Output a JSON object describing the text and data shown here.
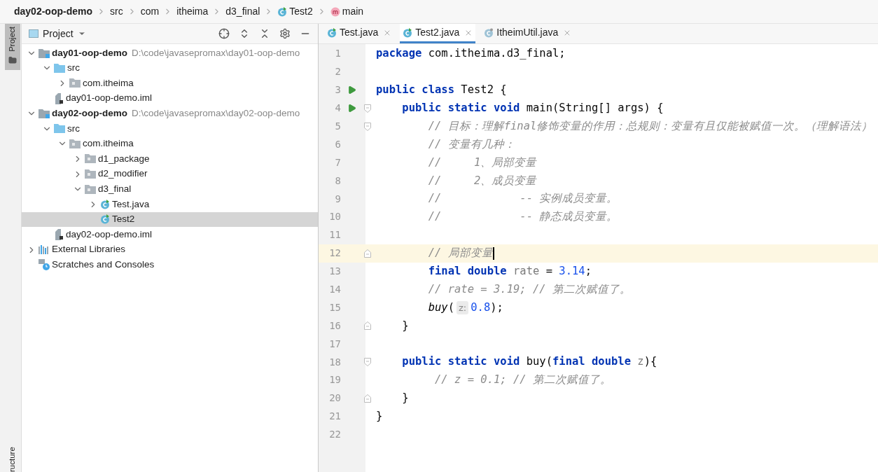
{
  "breadcrumb": [
    {
      "label": "day02-oop-demo",
      "kind": "project"
    },
    {
      "label": "src",
      "kind": "folder"
    },
    {
      "label": "com",
      "kind": "folder"
    },
    {
      "label": "itheima",
      "kind": "folder"
    },
    {
      "label": "d3_final",
      "kind": "folder"
    },
    {
      "label": "Test2",
      "kind": "class"
    },
    {
      "label": "main",
      "kind": "method"
    }
  ],
  "side_stripe": {
    "top": {
      "label": "Project",
      "selected": true
    },
    "bottom": {
      "label": "ructure",
      "selected": false
    }
  },
  "project_panel": {
    "title": "Project",
    "tree": [
      {
        "label": "day01-oop-demo",
        "path": "D:\\code\\javasepromax\\day01-oop-demo",
        "kind": "module",
        "expanded": true,
        "selected": false,
        "children": [
          {
            "label": "src",
            "kind": "source",
            "expanded": true,
            "selected": false,
            "children": [
              {
                "label": "com.itheima",
                "kind": "package",
                "expanded": false,
                "selected": false
              }
            ]
          },
          {
            "label": "day01-oop-demo.iml",
            "kind": "iml",
            "selected": false
          }
        ]
      },
      {
        "label": "day02-oop-demo",
        "path": "D:\\code\\javasepromax\\day02-oop-demo",
        "kind": "module",
        "expanded": true,
        "selected": false,
        "children": [
          {
            "label": "src",
            "kind": "source",
            "expanded": true,
            "selected": false,
            "children": [
              {
                "label": "com.itheima",
                "kind": "package",
                "expanded": true,
                "selected": false,
                "children": [
                  {
                    "label": "d1_package",
                    "kind": "package",
                    "expanded": false,
                    "selected": false
                  },
                  {
                    "label": "d2_modifier",
                    "kind": "package",
                    "expanded": false,
                    "selected": false
                  },
                  {
                    "label": "d3_final",
                    "kind": "package",
                    "expanded": true,
                    "selected": false,
                    "children": [
                      {
                        "label": "Test.java",
                        "kind": "class",
                        "expanded": false,
                        "selected": false
                      },
                      {
                        "label": "Test2",
                        "kind": "class",
                        "selected": true
                      }
                    ]
                  }
                ]
              }
            ]
          },
          {
            "label": "day02-oop-demo.iml",
            "kind": "iml",
            "selected": false
          }
        ]
      },
      {
        "label": "External Libraries",
        "kind": "libraries",
        "expanded": false,
        "selected": false
      },
      {
        "label": "Scratches and Consoles",
        "kind": "scratches",
        "selected": false
      }
    ]
  },
  "tabs": [
    {
      "label": "Test.java",
      "kind": "runnable",
      "selected": false
    },
    {
      "label": "Test2.java",
      "kind": "runnable",
      "selected": true
    },
    {
      "label": "ItheimUtil.java",
      "kind": "plain",
      "selected": false
    }
  ],
  "code": [
    {
      "number": "1",
      "current": false,
      "tokens": [
        {
          "kind": "kw",
          "text": "package"
        },
        {
          "kind": "plain",
          "text": " com.itheima.d3_final;"
        }
      ]
    },
    {
      "number": "2",
      "current": false
    },
    {
      "number": "3",
      "current": false,
      "run": true,
      "tokens": [
        {
          "kind": "kw",
          "text": "public class"
        },
        {
          "kind": "plain",
          "text": " Test2 {"
        }
      ]
    },
    {
      "number": "4",
      "current": false,
      "run": true,
      "fold_open": true,
      "tokens": [
        {
          "kind": "kw",
          "text": "    public static void"
        },
        {
          "kind": "plain",
          "text": " main(String[] args) {"
        }
      ]
    },
    {
      "number": "5",
      "current": false,
      "fold_open": true,
      "tokens": [
        {
          "kind": "comment",
          "text": "        // 目标：理解final修饰变量的作用：总规则：变量有且仅能被赋值一次。（理解语法）"
        }
      ]
    },
    {
      "number": "6",
      "current": false,
      "tokens": [
        {
          "kind": "comment",
          "text": "        // 变量有几种："
        }
      ]
    },
    {
      "number": "7",
      "current": false,
      "tokens": [
        {
          "kind": "comment",
          "text": "        //     1、局部变量"
        }
      ]
    },
    {
      "number": "8",
      "current": false,
      "tokens": [
        {
          "kind": "comment",
          "text": "        //     2、成员变量"
        }
      ]
    },
    {
      "number": "9",
      "current": false,
      "tokens": [
        {
          "kind": "comment",
          "text": "        //            -- 实例成员变量。"
        }
      ]
    },
    {
      "number": "10",
      "current": false,
      "tokens": [
        {
          "kind": "comment",
          "text": "        //            -- 静态成员变量。"
        }
      ]
    },
    {
      "number": "11",
      "current": false
    },
    {
      "number": "12",
      "current": true,
      "fold_close": true,
      "tokens": [
        {
          "kind": "comment",
          "text": "        // 局部变量"
        }
      ]
    },
    {
      "number": "13",
      "current": false,
      "tokens": [
        {
          "kind": "kw",
          "text": "        final double"
        },
        {
          "kind": "unused",
          "text": " rate"
        },
        {
          "kind": "plain",
          "text": " = "
        },
        {
          "kind": "num",
          "text": "3.14"
        },
        {
          "kind": "plain",
          "text": ";"
        }
      ]
    },
    {
      "number": "14",
      "current": false,
      "tokens": [
        {
          "kind": "comment",
          "text": "        // rate = 3.19; // 第二次赋值了。"
        }
      ]
    },
    {
      "number": "15",
      "current": false,
      "tokens": [
        {
          "kind": "call",
          "text": "        buy"
        },
        {
          "kind": "plain",
          "text": "("
        },
        {
          "kind": "hint",
          "text": "z:"
        },
        {
          "kind": "num",
          "text": "0.8"
        },
        {
          "kind": "plain",
          "text": ");"
        }
      ]
    },
    {
      "number": "16",
      "current": false,
      "fold_close": true,
      "tokens": [
        {
          "kind": "plain",
          "text": "    }"
        }
      ]
    },
    {
      "number": "17",
      "current": false
    },
    {
      "number": "18",
      "current": false,
      "fold_open": true,
      "tokens": [
        {
          "kind": "kw",
          "text": "    public static void"
        },
        {
          "kind": "plain",
          "text": " buy("
        },
        {
          "kind": "kw",
          "text": "final double"
        },
        {
          "kind": "unused",
          "text": " z"
        },
        {
          "kind": "plain",
          "text": "){"
        }
      ]
    },
    {
      "number": "19",
      "current": false,
      "tokens": [
        {
          "kind": "comment",
          "text": "         // z = 0.1; // 第二次赋值了。"
        }
      ]
    },
    {
      "number": "20",
      "current": false,
      "fold_close": true,
      "tokens": [
        {
          "kind": "plain",
          "text": "    }"
        }
      ]
    },
    {
      "number": "21",
      "current": false,
      "tokens": [
        {
          "kind": "plain",
          "text": "}"
        }
      ]
    },
    {
      "number": "22",
      "current": false
    }
  ]
}
